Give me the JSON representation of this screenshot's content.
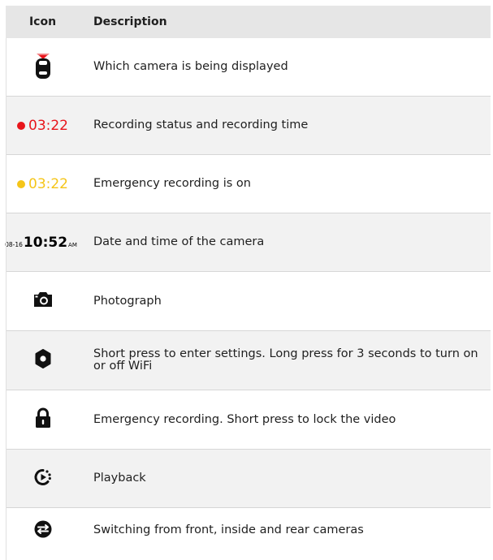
{
  "table": {
    "header": {
      "icon": "Icon",
      "description": "Description"
    },
    "rows": [
      {
        "icon": "camera-view-icon",
        "description": "Which camera is being displayed"
      },
      {
        "icon": "recording-time",
        "time": "03:22",
        "color": "#e8151b",
        "description": "Recording status and recording time"
      },
      {
        "icon": "emergency-recording-time",
        "time": "03:22",
        "color": "#f5c518",
        "description": "Emergency recording is on"
      },
      {
        "icon": "date-time",
        "date": "08-16",
        "time": "10:52",
        "ampm": "AM",
        "description": "Date and time of the camera"
      },
      {
        "icon": "camera-icon",
        "description": "Photograph"
      },
      {
        "icon": "gear-icon",
        "description": "Short press to enter settings. Long press for 3 seconds to turn on or off WiFi"
      },
      {
        "icon": "lock-icon",
        "description": "Emergency recording. Short press to lock the video"
      },
      {
        "icon": "playback-icon",
        "description": "Playback"
      },
      {
        "icon": "switch-camera-icon",
        "description": "Switching from front, inside and rear cameras"
      }
    ]
  }
}
